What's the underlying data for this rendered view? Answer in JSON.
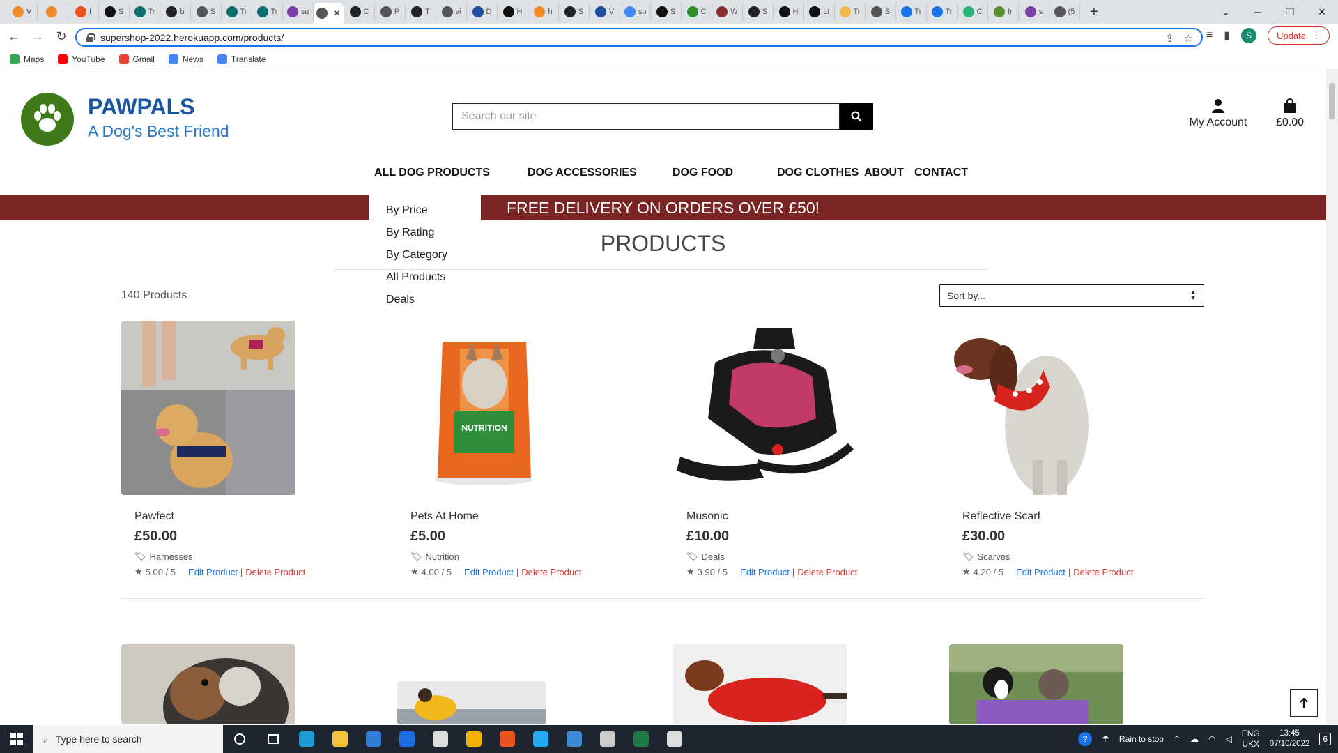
{
  "browser": {
    "tabs": [
      {
        "label": "V",
        "color": "#f28b2c"
      },
      {
        "label": "",
        "color": "#f28b2c"
      },
      {
        "label": "I",
        "color": "#e8541f"
      },
      {
        "label": "S",
        "color": "#111111"
      },
      {
        "label": "Tr",
        "color": "#0b6e6e"
      },
      {
        "label": "b",
        "color": "#222222"
      },
      {
        "label": "S",
        "color": "#555555"
      },
      {
        "label": "Tr",
        "color": "#0b6e6e"
      },
      {
        "label": "Tr",
        "color": "#0b6e6e"
      },
      {
        "label": "su",
        "color": "#7b3fa8"
      },
      {
        "label": "",
        "color": "#555555",
        "active": true
      },
      {
        "label": "C",
        "color": "#222222"
      },
      {
        "label": "P",
        "color": "#555555"
      },
      {
        "label": "T",
        "color": "#222222"
      },
      {
        "label": "vi",
        "color": "#555555"
      },
      {
        "label": "D",
        "color": "#1f4e9c"
      },
      {
        "label": "H",
        "color": "#111111"
      },
      {
        "label": "h",
        "color": "#f28b2c"
      },
      {
        "label": "S",
        "color": "#222222"
      },
      {
        "label": "V",
        "color": "#1f4e9c"
      },
      {
        "label": "sp",
        "color": "#4285f4"
      },
      {
        "label": "S",
        "color": "#111111"
      },
      {
        "label": "C",
        "color": "#2f8f2f"
      },
      {
        "label": "W",
        "color": "#8a3030"
      },
      {
        "label": "S",
        "color": "#222222"
      },
      {
        "label": "H",
        "color": "#111111"
      },
      {
        "label": "Li",
        "color": "#111111"
      },
      {
        "label": "Tr",
        "color": "#f2b84b"
      },
      {
        "label": "S",
        "color": "#555555"
      },
      {
        "label": "Tr",
        "color": "#1a73e8"
      },
      {
        "label": "Tr",
        "color": "#1a73e8"
      },
      {
        "label": "C",
        "color": "#2ab27b"
      },
      {
        "label": "Ir",
        "color": "#5b8f2f"
      },
      {
        "label": "s",
        "color": "#7b3fa8"
      },
      {
        "label": "(5",
        "color": "#555555"
      }
    ],
    "url": "supershop-2022.herokuapp.com/products/",
    "update_label": "Update",
    "profile_initial": "S",
    "bookmarks": [
      {
        "label": "Maps",
        "color": "#34a853"
      },
      {
        "label": "YouTube",
        "color": "#ff0000"
      },
      {
        "label": "Gmail",
        "color": "#ea4335"
      },
      {
        "label": "News",
        "color": "#4285f4"
      },
      {
        "label": "Translate",
        "color": "#4285f4"
      }
    ]
  },
  "site": {
    "brand_name": "PAWPALS",
    "tagline": "A Dog's Best Friend",
    "search_placeholder": "Search our site",
    "account_label": "My Account",
    "cart_total": "£0.00",
    "nav": [
      "ALL DOG PRODUCTS",
      "DOG ACCESSORIES",
      "DOG FOOD",
      "DOG CLOTHES",
      "ABOUT",
      "CONTACT"
    ],
    "dropdown": [
      "By Price",
      "By Rating",
      "By Category",
      "All Products",
      "Deals"
    ],
    "banner": "FREE DELIVERY ON ORDERS OVER £50!",
    "page_title": "PRODUCTS",
    "product_count": "140 Products",
    "sort_label": "Sort by...",
    "edit_label": "Edit Product",
    "delete_label": "Delete Product",
    "separator": "|",
    "products": [
      {
        "name": "Pawfect",
        "price": "£50.00",
        "category": "Harnesses",
        "rating": "5.00 / 5"
      },
      {
        "name": "Pets At Home",
        "price": "£5.00",
        "category": "Nutrition",
        "rating": "4.00 / 5"
      },
      {
        "name": "Musonic",
        "price": "£10.00",
        "category": "Deals",
        "rating": "3.90 / 5"
      },
      {
        "name": "Reflective Scarf",
        "price": "£30.00",
        "category": "Scarves",
        "rating": "4.20 / 5"
      }
    ],
    "colors": {
      "brand_blue": "#1656a3",
      "banner_red": "#7b2424",
      "logo_green": "#3e7a1a",
      "edit_link": "#1a73e8",
      "delete_link": "#e03a3a"
    }
  },
  "taskbar": {
    "search_placeholder": "Type here to search",
    "weather": "Rain to stop",
    "language": "ENG",
    "region": "UKX",
    "time": "13:45",
    "date": "07/10/2022",
    "notifications": "6",
    "apps": [
      {
        "name": "edge",
        "color": "#1c9bd6"
      },
      {
        "name": "file-explorer",
        "color": "#f5c242"
      },
      {
        "name": "mail",
        "color": "#2f7fd6"
      },
      {
        "name": "dropbox",
        "color": "#1a6fe0"
      },
      {
        "name": "github-desktop",
        "color": "#dddddd"
      },
      {
        "name": "chrome",
        "color": "#f2b400"
      },
      {
        "name": "office",
        "color": "#e8541f"
      },
      {
        "name": "vscode",
        "color": "#23a9f2"
      },
      {
        "name": "photos",
        "color": "#3b8bd9"
      },
      {
        "name": "calendar",
        "color": "#cccccc"
      },
      {
        "name": "excel",
        "color": "#1d7a44"
      },
      {
        "name": "paint",
        "color": "#dddddd"
      }
    ]
  }
}
